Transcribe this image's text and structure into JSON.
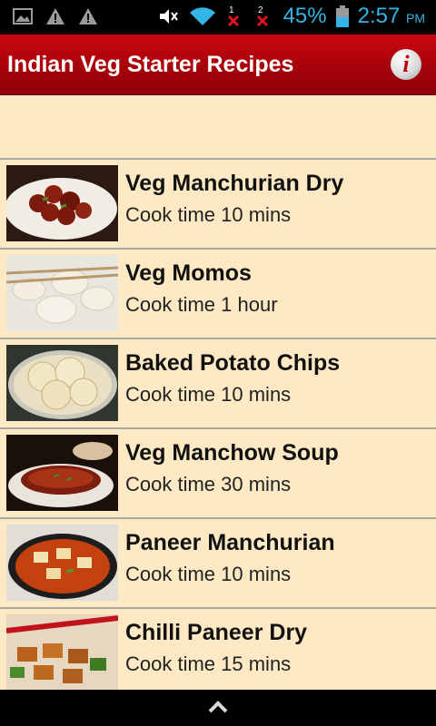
{
  "status_bar": {
    "battery_percent": "45%",
    "time": "2:57",
    "ampm": "PM",
    "sim1": "1",
    "sim2": "2",
    "icons": [
      "image-icon",
      "warning-icon",
      "warning-icon",
      "mute-icon",
      "wifi-icon",
      "no-signal-icon",
      "no-signal-icon",
      "battery-icon"
    ]
  },
  "app_bar": {
    "title": "Indian Veg Starter Recipes",
    "info_label": "i",
    "color": "#b3040c"
  },
  "recipes": [
    {
      "title": "Veg Manchurian Dry",
      "subtitle": "Cook time 10 mins"
    },
    {
      "title": "Veg Momos",
      "subtitle": "Cook time 1 hour"
    },
    {
      "title": "Baked Potato Chips",
      "subtitle": "Cook time 10 mins"
    },
    {
      "title": "Veg Manchow Soup",
      "subtitle": "Cook time 30 mins"
    },
    {
      "title": "Paneer Manchurian",
      "subtitle": "Cook time 10 mins"
    },
    {
      "title": "Chilli Paneer Dry",
      "subtitle": "Cook time 15 mins"
    }
  ],
  "nav_bar": {
    "icon": "up-chevron-icon"
  },
  "colors": {
    "background": "#fde9c3",
    "status_accent": "#33b5e5",
    "divider": "#a7a7a7"
  }
}
